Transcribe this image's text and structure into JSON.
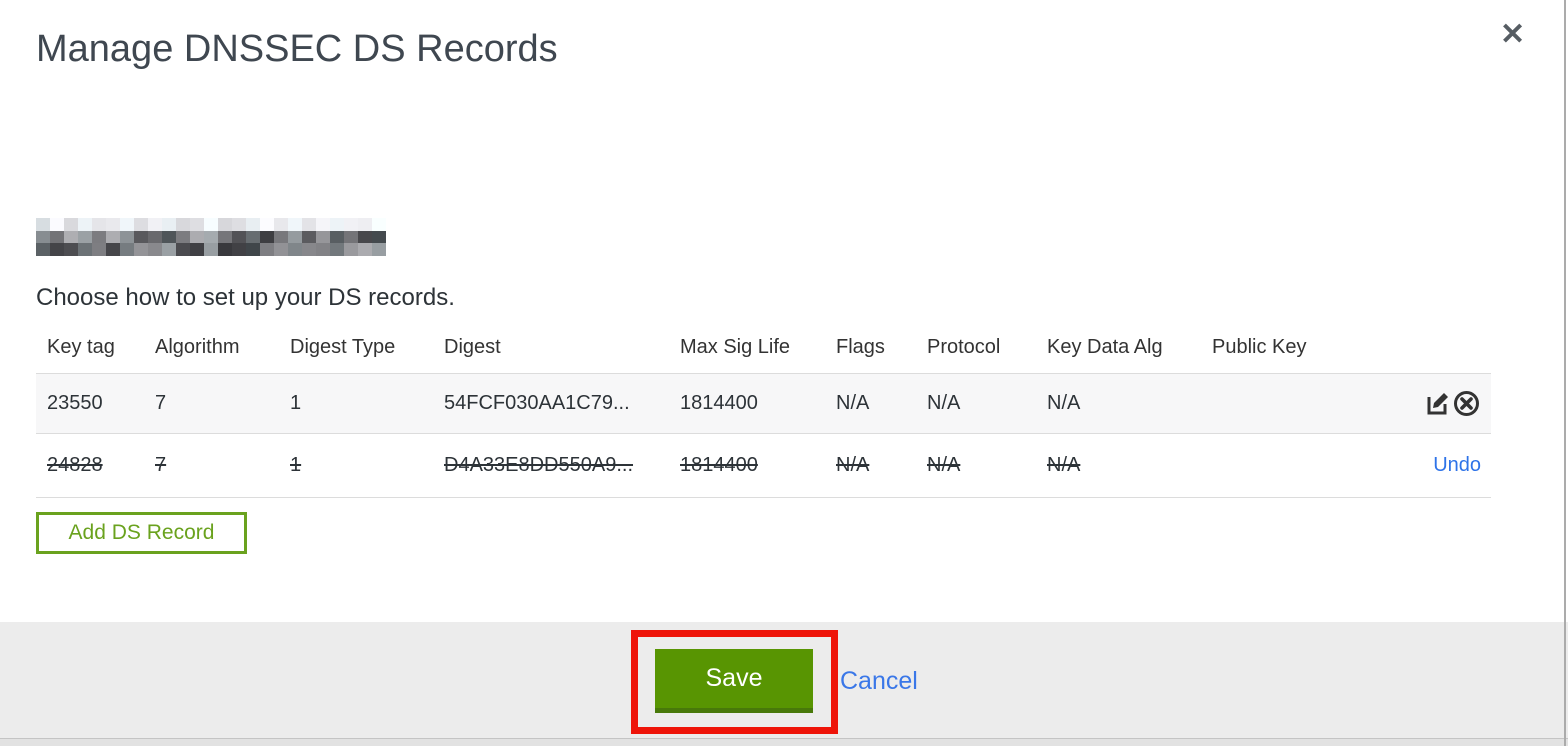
{
  "dialog": {
    "title": "Manage DNSSEC DS Records",
    "subtitle": "Choose how to set up your DS records.",
    "close_icon": "✕",
    "domain_redacted": true
  },
  "table": {
    "columns": {
      "key_tag": "Key tag",
      "algorithm": "Algorithm",
      "digest_type": "Digest Type",
      "digest": "Digest",
      "max_sig_life": "Max Sig Life",
      "flags": "Flags",
      "protocol": "Protocol",
      "key_data_alg": "Key Data Alg",
      "public_key": "Public Key"
    },
    "rows": [
      {
        "key_tag": "23550",
        "algorithm": "7",
        "digest_type": "1",
        "digest": "54FCF030AA1C79...",
        "max_sig_life": "1814400",
        "flags": "N/A",
        "protocol": "N/A",
        "key_data_alg": "N/A",
        "public_key": "",
        "state": "current",
        "actions": [
          "edit",
          "delete"
        ]
      },
      {
        "key_tag": "24828",
        "algorithm": "7",
        "digest_type": "1",
        "digest": "D4A33E8DD550A9...",
        "max_sig_life": "1814400",
        "flags": "N/A",
        "protocol": "N/A",
        "key_data_alg": "N/A",
        "public_key": "",
        "state": "deleted",
        "undo_label": "Undo"
      }
    ]
  },
  "buttons": {
    "add_ds_record": "Add DS Record",
    "save": "Save",
    "cancel": "Cancel"
  },
  "icons": {
    "edit": "pencil-in-square",
    "delete": "x-in-circle",
    "close": "x-mark"
  },
  "colors": {
    "green_outline": "#6aa21e",
    "save_green": "#589502",
    "link_blue": "#2e73e8",
    "annotation_red": "#ee1409",
    "row_alt_bg": "#f7f7f8",
    "footer_bg": "#ececec"
  }
}
